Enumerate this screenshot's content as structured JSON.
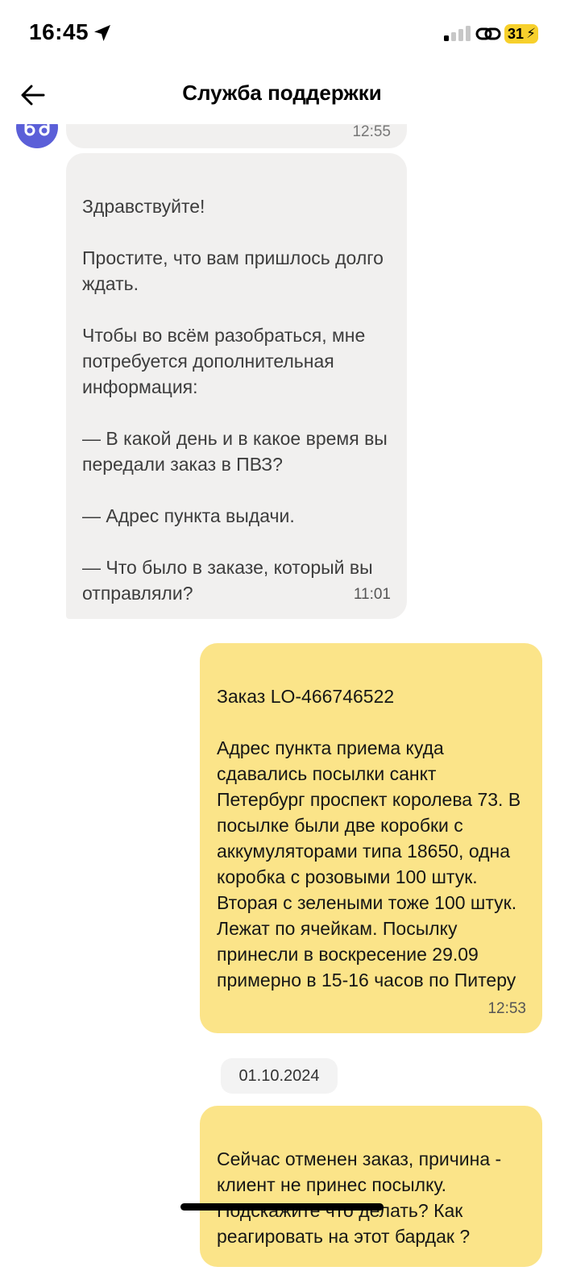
{
  "status_bar": {
    "time": "16:45",
    "battery": "31"
  },
  "header": {
    "title": "Служба поддержки"
  },
  "messages": [
    {
      "side": "incoming",
      "text": "",
      "time": "12:55"
    },
    {
      "side": "incoming",
      "text": "Здравствуйте!\n\nПростите, что вам пришлось долго ждать.\n\nЧтобы во всём разобраться, мне потребуется дополнительная информация:\n\n— В какой день и в какое время вы передали заказ в ПВЗ?\n\n— Адрес пункта выдачи.\n\n— Что было в заказе, который вы отправляли?",
      "time": "11:01"
    },
    {
      "side": "outgoing",
      "text": "Заказ LO-466746522\n\nАдрес пункта приема куда сдавались посылки санкт Петербург проспект королева 73. В посылке были две коробки с аккумуляторами типа 18650, одна коробка с розовыми 100 штук. Вторая с зелеными тоже 100 штук. Лежат по ячейкам. Посылку принесли в воскресение 29.09 примерно в 15-16 часов по Питеру",
      "time": "12:53"
    },
    {
      "side": "outgoing",
      "text": "Сейчас отменен заказ, причина - клиент не принес посылку. Подскажите что делать? Как реагировать на этот бардак ?",
      "time": ""
    }
  ],
  "date_separator": "01.10.2024",
  "colors": {
    "incoming_bubble": "#f1f0ef",
    "outgoing_bubble": "#fbe489",
    "avatar": "#5b5fd8",
    "battery": "#f7d02c"
  },
  "icons": {
    "back": "arrow-left-icon",
    "location": "location-arrow-icon",
    "signal": "cellular-signal-icon",
    "link": "personal-hotspot-icon",
    "avatar": "support-avatar-icon"
  }
}
